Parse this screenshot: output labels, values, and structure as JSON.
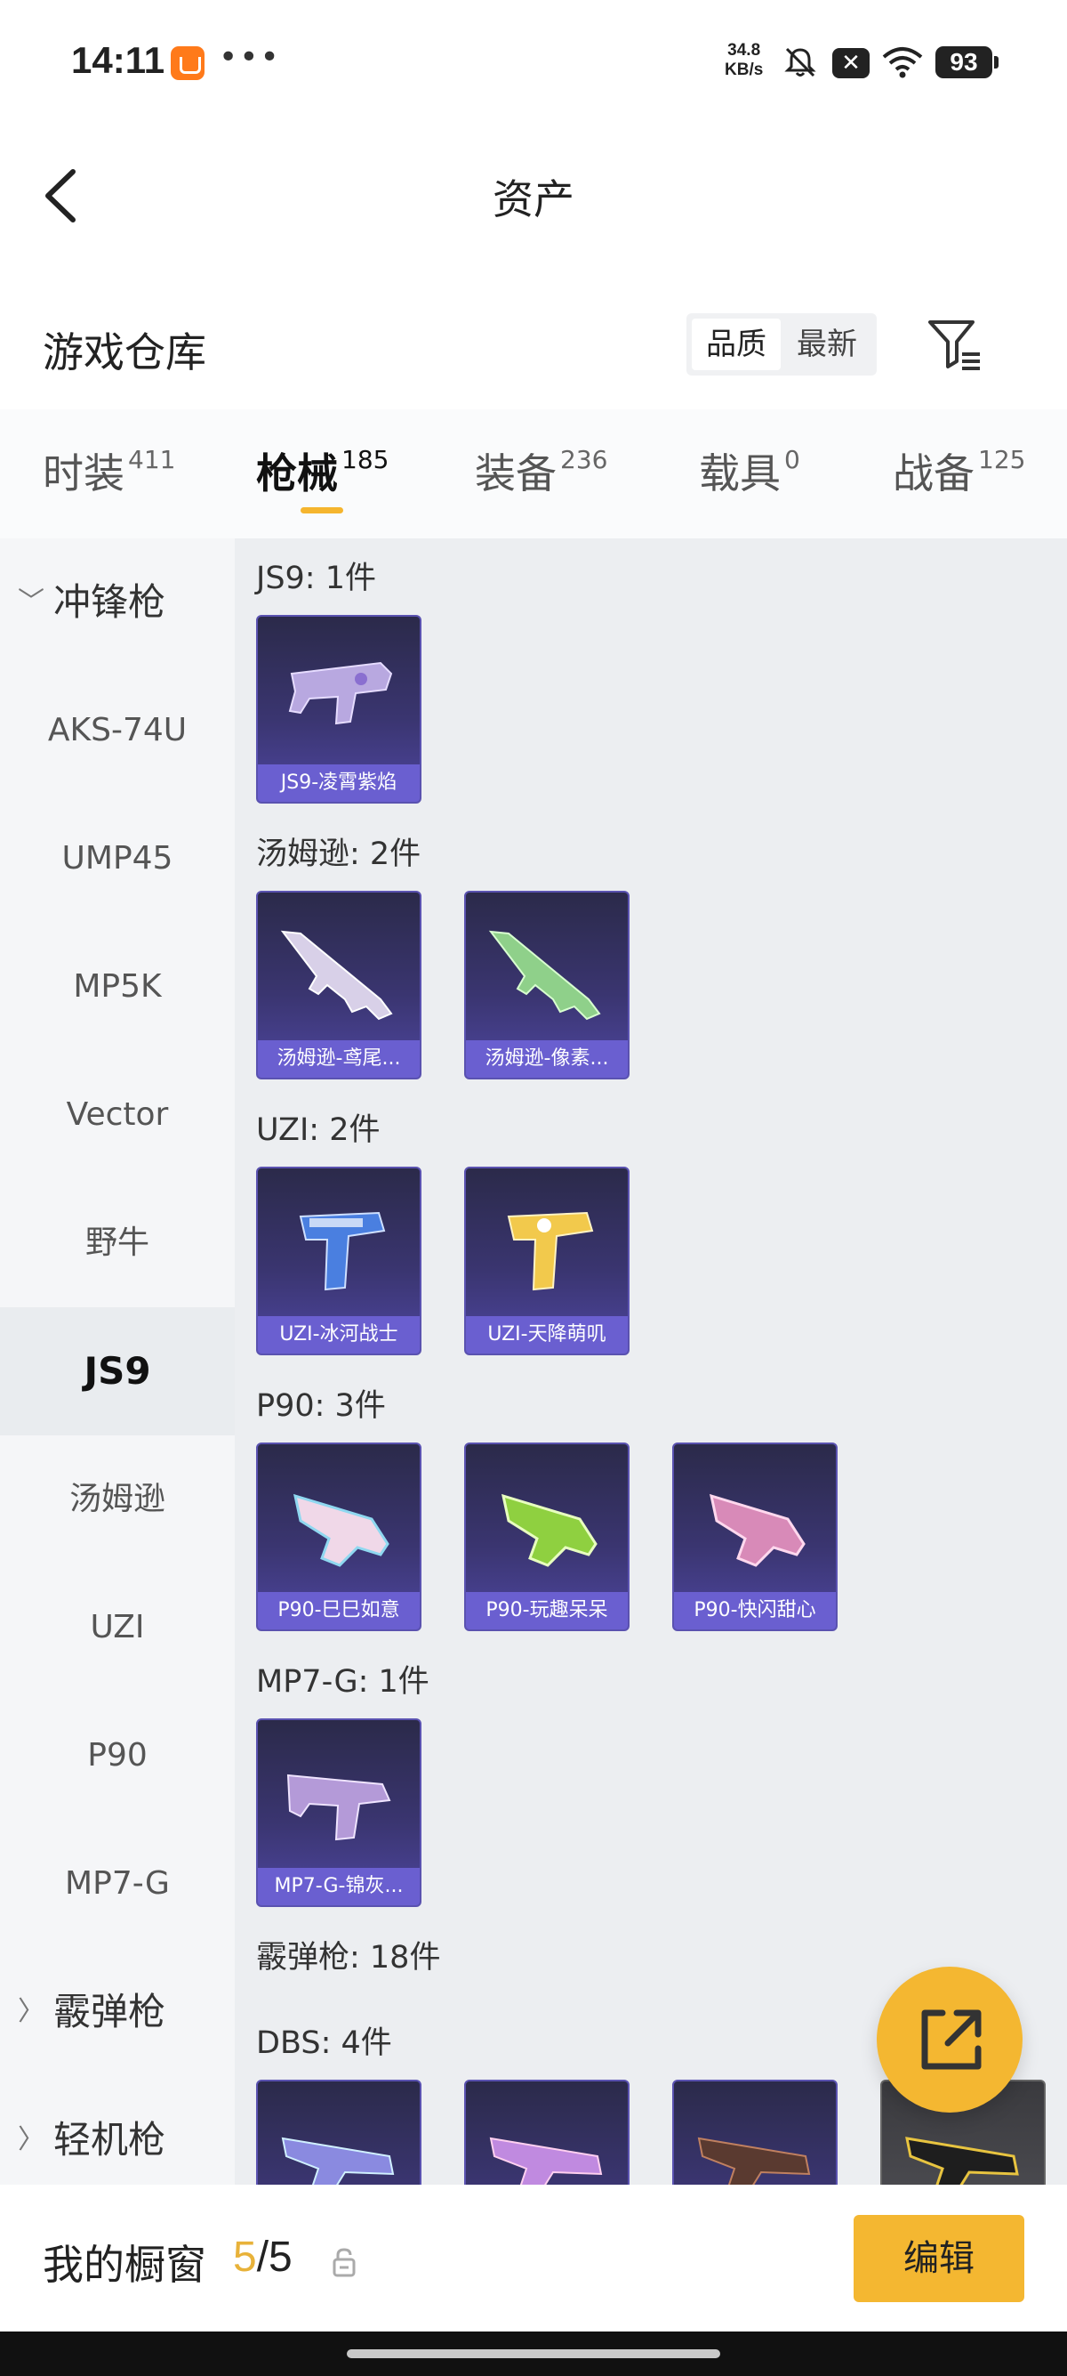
{
  "status_bar": {
    "time": "14:11",
    "dots": "•••",
    "speed_value": "34.8",
    "speed_unit": "KB/s",
    "x_badge": "✕",
    "battery": "93"
  },
  "nav": {
    "title": "资产"
  },
  "warehouse": {
    "title": "游戏仓库",
    "sort_options": [
      "品质",
      "最新"
    ],
    "active_sort": "品质"
  },
  "category_tabs": [
    {
      "label": "时装",
      "count": "411"
    },
    {
      "label": "枪械",
      "count": "185"
    },
    {
      "label": "装备",
      "count": "236"
    },
    {
      "label": "载具",
      "count": "0"
    },
    {
      "label": "战备",
      "count": "125"
    }
  ],
  "active_tab": "枪械",
  "sidebar": {
    "items": [
      {
        "label": "冲锋枪",
        "type": "group",
        "caret": "﹀"
      },
      {
        "label": "AKS-74U",
        "type": "item"
      },
      {
        "label": "UMP45",
        "type": "item"
      },
      {
        "label": "MP5K",
        "type": "item"
      },
      {
        "label": "Vector",
        "type": "item"
      },
      {
        "label": "野牛",
        "type": "item"
      },
      {
        "label": "JS9",
        "type": "item",
        "active": true
      },
      {
        "label": "汤姆逊",
        "type": "item"
      },
      {
        "label": "UZI",
        "type": "item"
      },
      {
        "label": "P90",
        "type": "item"
      },
      {
        "label": "MP7-G",
        "type": "item"
      },
      {
        "label": "霰弹枪",
        "type": "group",
        "caret": "〉"
      },
      {
        "label": "轻机枪",
        "type": "group",
        "caret": "〉"
      }
    ]
  },
  "sections": [
    {
      "title": "JS9: 1件",
      "items": [
        "JS9-凌霄紫焰"
      ]
    },
    {
      "title": "汤姆逊: 2件",
      "items": [
        "汤姆逊-鸢尾...",
        "汤姆逊-像素..."
      ]
    },
    {
      "title": "UZI: 2件",
      "items": [
        "UZI-冰河战士",
        "UZI-天降萌叽"
      ]
    },
    {
      "title": "P90: 3件",
      "items": [
        "P90-巳巳如意",
        "P90-玩趣呆呆",
        "P90-快闪甜心"
      ]
    },
    {
      "title": "MP7-G: 1件",
      "items": [
        "MP7-G-锦灰..."
      ]
    },
    {
      "title": "霰弹枪: 18件",
      "items": []
    },
    {
      "title": "DBS: 4件",
      "items": [
        "",
        "",
        "",
        ""
      ]
    }
  ],
  "bottom_bar": {
    "label": "我的橱窗",
    "current": "5",
    "separator": "/",
    "total": "5",
    "edit_label": "编辑"
  },
  "colors": {
    "accent": "#f4b731",
    "card_bg": "#3a3570",
    "card_caption": "#6a5fd0"
  }
}
